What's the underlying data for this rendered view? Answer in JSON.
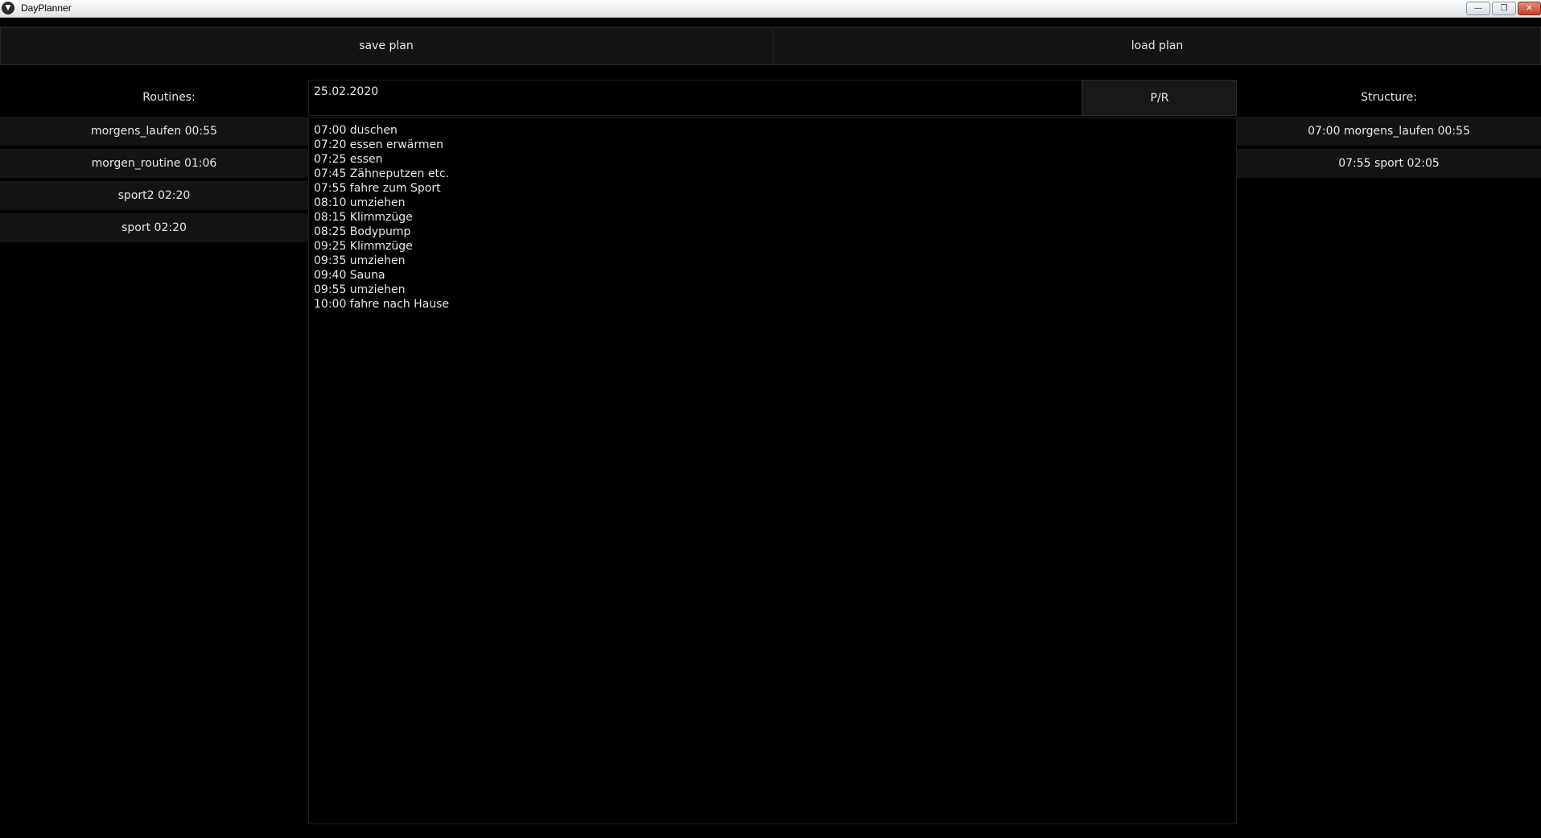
{
  "window": {
    "title": "DayPlanner",
    "icon": "app-logo-icon"
  },
  "toolbar": {
    "save_label": "save plan",
    "load_label": "load plan"
  },
  "routines": {
    "heading": "Routines:",
    "items": [
      {
        "label": "morgens_laufen 00:55"
      },
      {
        "label": "morgen_routine 01:06"
      },
      {
        "label": "sport2 02:20"
      },
      {
        "label": "sport 02:20"
      }
    ]
  },
  "plan": {
    "date": "25.02.2020",
    "pr_label": "P/R",
    "lines": [
      "07:00 duschen",
      "07:20 essen erwärmen",
      "07:25 essen",
      "07:45 Zähneputzen etc.",
      "07:55 fahre zum Sport",
      "08:10 umziehen",
      "08:15 Klimmzüge",
      "08:25 Bodypump",
      "09:25 Klimmzüge",
      "09:35 umziehen",
      "09:40 Sauna",
      "09:55 umziehen",
      "10:00 fahre nach Hause"
    ]
  },
  "structure": {
    "heading": "Structure:",
    "items": [
      {
        "label": "07:00 morgens_laufen 00:55"
      },
      {
        "label": "07:55 sport 02:05"
      }
    ]
  }
}
